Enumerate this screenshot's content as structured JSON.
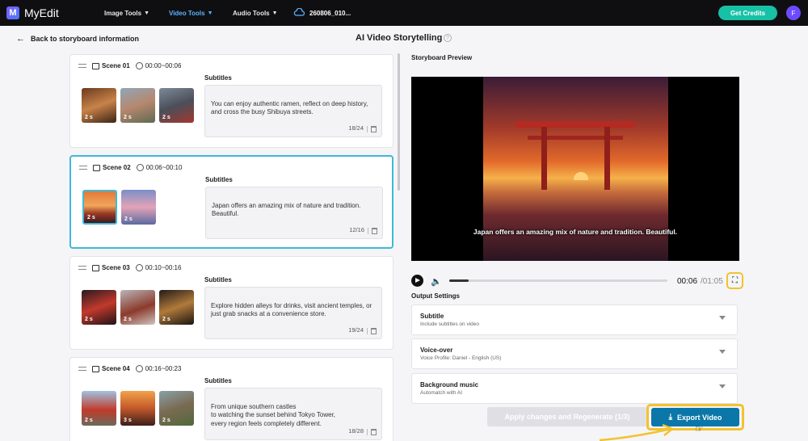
{
  "app": {
    "name": "MyEdit",
    "logo_letter": "M"
  },
  "nav": [
    {
      "label": "Image Tools",
      "active": false
    },
    {
      "label": "Video Tools",
      "active": true
    },
    {
      "label": "Audio Tools",
      "active": false
    }
  ],
  "project": {
    "name": "260806_010..."
  },
  "header_actions": {
    "credits_label": "Get Credits",
    "avatar_letter": "F"
  },
  "page": {
    "back_label": "Back to storyboard information",
    "title": "AI Video Storytelling"
  },
  "scenes": [
    {
      "name": "Scene 01",
      "time": "00:00~00:06",
      "subtitles_label": "Subtitles",
      "subtitle": "You can enjoy authentic ramen, reflect on deep history,\nand cross the busy Shibuya streets.",
      "count": "18/24",
      "thumbs": [
        "2 s",
        "2 s",
        "2 s"
      ]
    },
    {
      "name": "Scene 02",
      "time": "00:06~00:10",
      "subtitles_label": "Subtitles",
      "subtitle": "Japan offers an amazing mix of nature and tradition. Beautiful.",
      "count": "12/16",
      "thumbs": [
        "2 s",
        "2 s"
      ]
    },
    {
      "name": "Scene 03",
      "time": "00:10~00:16",
      "subtitles_label": "Subtitles",
      "subtitle": "Explore hidden alleys for drinks, visit ancient temples, or just grab snacks at a convenience store.",
      "count": "19/24",
      "thumbs": [
        "2 s",
        "2 s",
        "2 s"
      ]
    },
    {
      "name": "Scene 04",
      "time": "00:16~00:23",
      "subtitles_label": "Subtitles",
      "subtitle": "From unique southern castles\nto watching the sunset behind Tokyo Tower,\nevery region feels completely different.",
      "count": "18/28",
      "thumbs": [
        "2 s",
        "3 s",
        "2 s"
      ]
    }
  ],
  "preview": {
    "label": "Storyboard Preview",
    "caption": "Japan offers an amazing mix of nature and tradition. Beautiful.",
    "current_time": "00:06",
    "total_time": "/01:05",
    "progress_fraction": 0.09
  },
  "output_settings": {
    "label": "Output Settings",
    "items": [
      {
        "title": "Subtitle",
        "desc": "Include subtitles on video"
      },
      {
        "title": "Voice-over",
        "desc": "Voice Profile: Daniel - English (US)"
      },
      {
        "title": "Background music",
        "desc": "Automatch with AI"
      }
    ]
  },
  "actions": {
    "apply_label": "Apply changes and Regenerate (1/3)",
    "export_label": "Export Video"
  },
  "colors": {
    "accent": "#17c1a6",
    "highlight": "#f2c230",
    "export": "#0a77a8",
    "selected_border": "#3fb8d9"
  }
}
